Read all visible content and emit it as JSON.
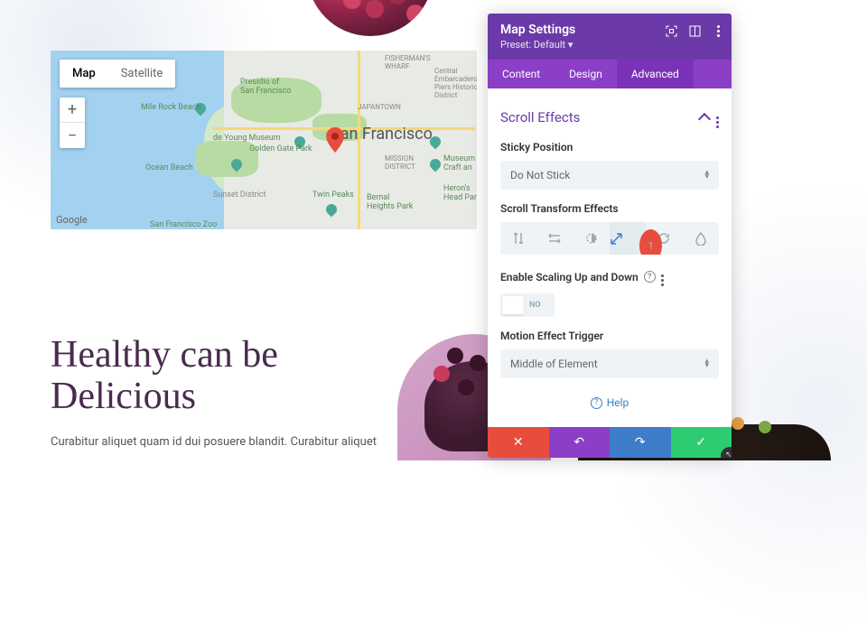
{
  "panel": {
    "title": "Map Settings",
    "preset": "Preset: Default",
    "tabs": {
      "content": "Content",
      "design": "Design",
      "advanced": "Advanced"
    },
    "section": "Scroll Effects",
    "sticky_label": "Sticky Position",
    "sticky_value": "Do Not Stick",
    "transform_label": "Scroll Transform Effects",
    "scaling_label": "Enable Scaling Up and Down",
    "scaling_value": "NO",
    "trigger_label": "Motion Effect Trigger",
    "trigger_value": "Middle of Element",
    "help": "Help",
    "badge": "1"
  },
  "map": {
    "type_map": "Map",
    "type_sat": "Satellite",
    "city": "San Francisco",
    "logo": "Google",
    "labels": {
      "presidio": "Presidio of\nSan Francisco",
      "milerock": "Mile Rock Beach",
      "deyoung": "de Young Museum",
      "ggpark": "Golden Gate Park",
      "ocean": "Ocean Beach",
      "sunset": "Sunset District",
      "sfzoo": "San Francisco Zoo",
      "twinpeaks": "Twin Peaks",
      "mission": "MISSION\nDISTRICT",
      "japantown": "JAPANTOWN",
      "bernal": "Bernal\nHeights Park",
      "fishwharf": "FISHERMAN'S\nWHARF",
      "embarc": "Central\nEmbarcadero\nPiers Historic\nDistrict",
      "craft": "Museum\nCraft an",
      "headpar": "Heron's\nHead Par"
    }
  },
  "page": {
    "headline": "Healthy can be\nDelicious",
    "body": "Curabitur aliquet quam id dui posuere blandit. Curabitur aliquet"
  }
}
